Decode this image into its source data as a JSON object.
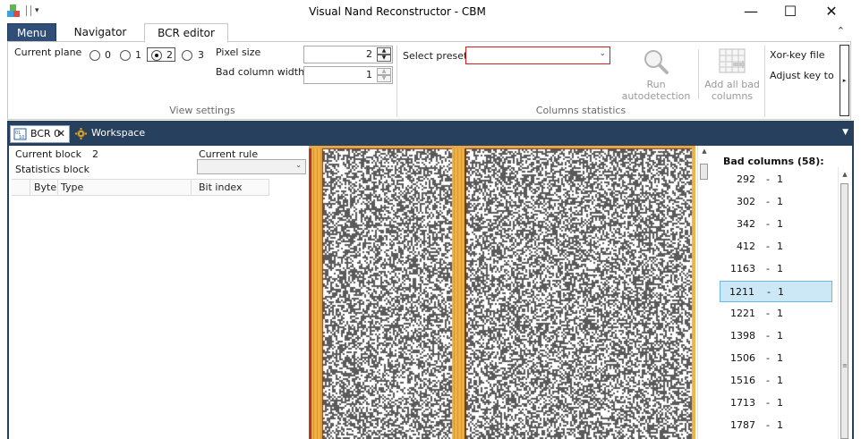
{
  "window": {
    "title": "Visual Nand Reconstructor - CBM",
    "minimize_glyph": "—",
    "maximize_glyph": "☐",
    "close_glyph": "✕",
    "qa_dropdown_glyph": "▾"
  },
  "ribbon_tabs": {
    "menu_label": "Menu",
    "tabs": [
      "Navigator",
      "BCR editor"
    ],
    "active_tab": "BCR editor",
    "collapse_glyph": "⌃"
  },
  "view_settings": {
    "current_plane_label": "Current plane",
    "plane_options": [
      "0",
      "1",
      "2",
      "3"
    ],
    "plane_selected": "2",
    "pixel_size_label": "Pixel size",
    "pixel_size_value": "2",
    "bad_column_width_label": "Bad column width",
    "bad_column_width_value": "1",
    "group_caption": "View settings"
  },
  "columns_statistics": {
    "select_preset_label": "Select preset",
    "select_preset_value": "",
    "run_autodetection_label_1": "Run",
    "run_autodetection_label_2": "autodetection",
    "add_all_bad_columns_label_1": "Add all bad",
    "add_all_bad_columns_label_2": "columns",
    "group_caption": "Columns statistics",
    "xor_key_file_label": "Xor-key file",
    "adjust_key_label": "Adjust key to p",
    "scroll_glyph": "▸"
  },
  "document_tabs": {
    "tabs": [
      {
        "label": "BCR 0",
        "icon": "bcr-icon",
        "active": true
      },
      {
        "label": "Workspace",
        "icon": "workspace-gear-icon",
        "active": false
      }
    ],
    "close_glyph": "✕",
    "menu_glyph": "▼"
  },
  "left_panel": {
    "current_block_label": "Current block",
    "current_block_value": "2",
    "statistics_block_label": "Statistics block",
    "current_rule_label": "Current rule",
    "current_rule_value": "",
    "grid_columns": [
      "Byte",
      "Type",
      "Bit index"
    ]
  },
  "bad_columns": {
    "title": "Bad columns (58):",
    "separator": "-",
    "items": [
      {
        "column": "292",
        "width": "1"
      },
      {
        "column": "302",
        "width": "1"
      },
      {
        "column": "342",
        "width": "1"
      },
      {
        "column": "412",
        "width": "1"
      },
      {
        "column": "1163",
        "width": "1"
      },
      {
        "column": "1211",
        "width": "1"
      },
      {
        "column": "1221",
        "width": "1"
      },
      {
        "column": "1398",
        "width": "1"
      },
      {
        "column": "1506",
        "width": "1"
      },
      {
        "column": "1516",
        "width": "1"
      },
      {
        "column": "1713",
        "width": "1"
      },
      {
        "column": "1787",
        "width": "1"
      }
    ],
    "selected_column": "1211"
  },
  "colors": {
    "menu_button": "#2f4f78",
    "doc_area": "#26405e",
    "preset_border": "#d31c1c",
    "selection": "#cce8f6",
    "bad_column_stripe": "#f0b347",
    "bitmap_dark": "#5a5a5a",
    "bitmap_light": "#ffffff"
  }
}
